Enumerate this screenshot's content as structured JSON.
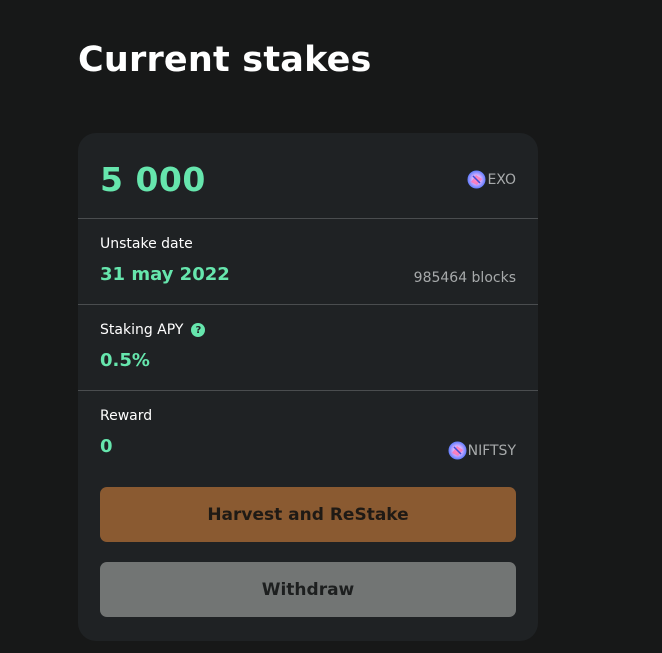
{
  "page": {
    "title": "Current stakes"
  },
  "stake": {
    "amount": "5 000",
    "token": "EXO",
    "unstake": {
      "label": "Unstake date",
      "date": "31 may 2022",
      "blocks": "985464 blocks"
    },
    "apy": {
      "label": "Staking APY",
      "value": "0.5%",
      "help_icon": "question-circle-icon"
    },
    "reward": {
      "label": "Reward",
      "value": "0",
      "token": "NIFTSY"
    }
  },
  "buttons": {
    "harvest_label": "Harvest and ReStake",
    "withdraw_label": "Withdraw"
  },
  "colors": {
    "background": "#171818",
    "card": "#1f2224",
    "accent": "#66e6ad",
    "harvest_button": "#8a5a31",
    "withdraw_button": "#727574"
  }
}
